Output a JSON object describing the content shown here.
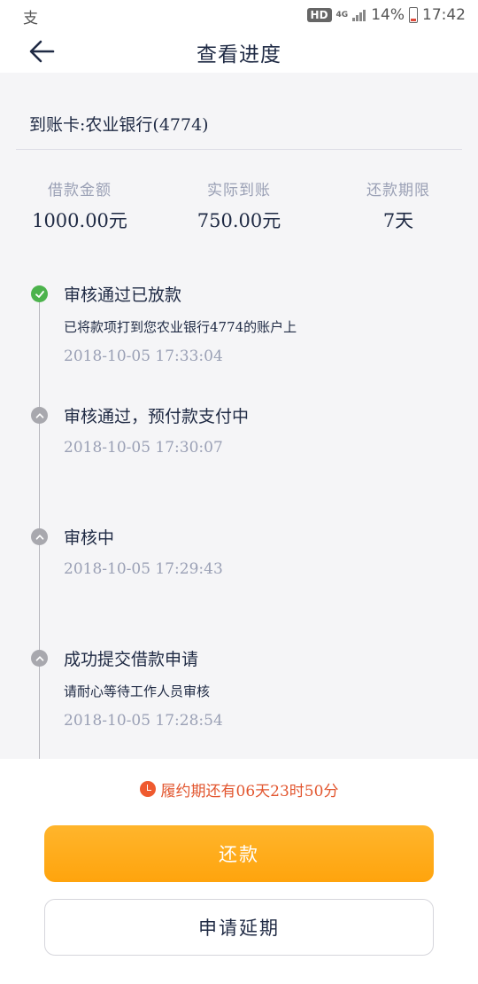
{
  "status_bar": {
    "left_icon": "alipay-icon",
    "left_glyph": "支",
    "hd": "HD",
    "network": "4G",
    "battery": "14%",
    "time": "17:42"
  },
  "header": {
    "back_icon": "arrow-left-icon",
    "title": "查看进度"
  },
  "card": {
    "text": "到账卡:农业银行(4774)"
  },
  "stats": [
    {
      "label": "借款金额",
      "value": "1000.00元"
    },
    {
      "label": "实际到账",
      "value": "750.00元"
    },
    {
      "label": "还款期限",
      "value": "7天"
    }
  ],
  "timeline": [
    {
      "title": "审核通过已放款",
      "desc": "已将款项打到您农业银行4774的账户上",
      "time": "2018-10-05 17:33:04",
      "status": "done",
      "icon": "check-circle-icon"
    },
    {
      "title": "审核通过，预付款支付中",
      "desc": "",
      "time": "2018-10-05 17:30:07",
      "status": "pending",
      "icon": "chevron-up-circle-icon"
    },
    {
      "title": "审核中",
      "desc": "",
      "time": "2018-10-05 17:29:43",
      "status": "pending",
      "icon": "chevron-up-circle-icon"
    },
    {
      "title": "成功提交借款申请",
      "desc": "请耐心等待工作人员审核",
      "time": "2018-10-05 17:28:54",
      "status": "pending",
      "icon": "chevron-up-circle-icon"
    }
  ],
  "countdown": {
    "icon": "clock-icon",
    "text": "履约期还有06天23时50分"
  },
  "buttons": {
    "repay": "还款",
    "extend": "申请延期"
  },
  "colors": {
    "accent_orange": "#ffa40d",
    "countdown_red": "#e2562f",
    "done_green": "#4cb34c",
    "pending_grey": "#a8a8ae"
  }
}
